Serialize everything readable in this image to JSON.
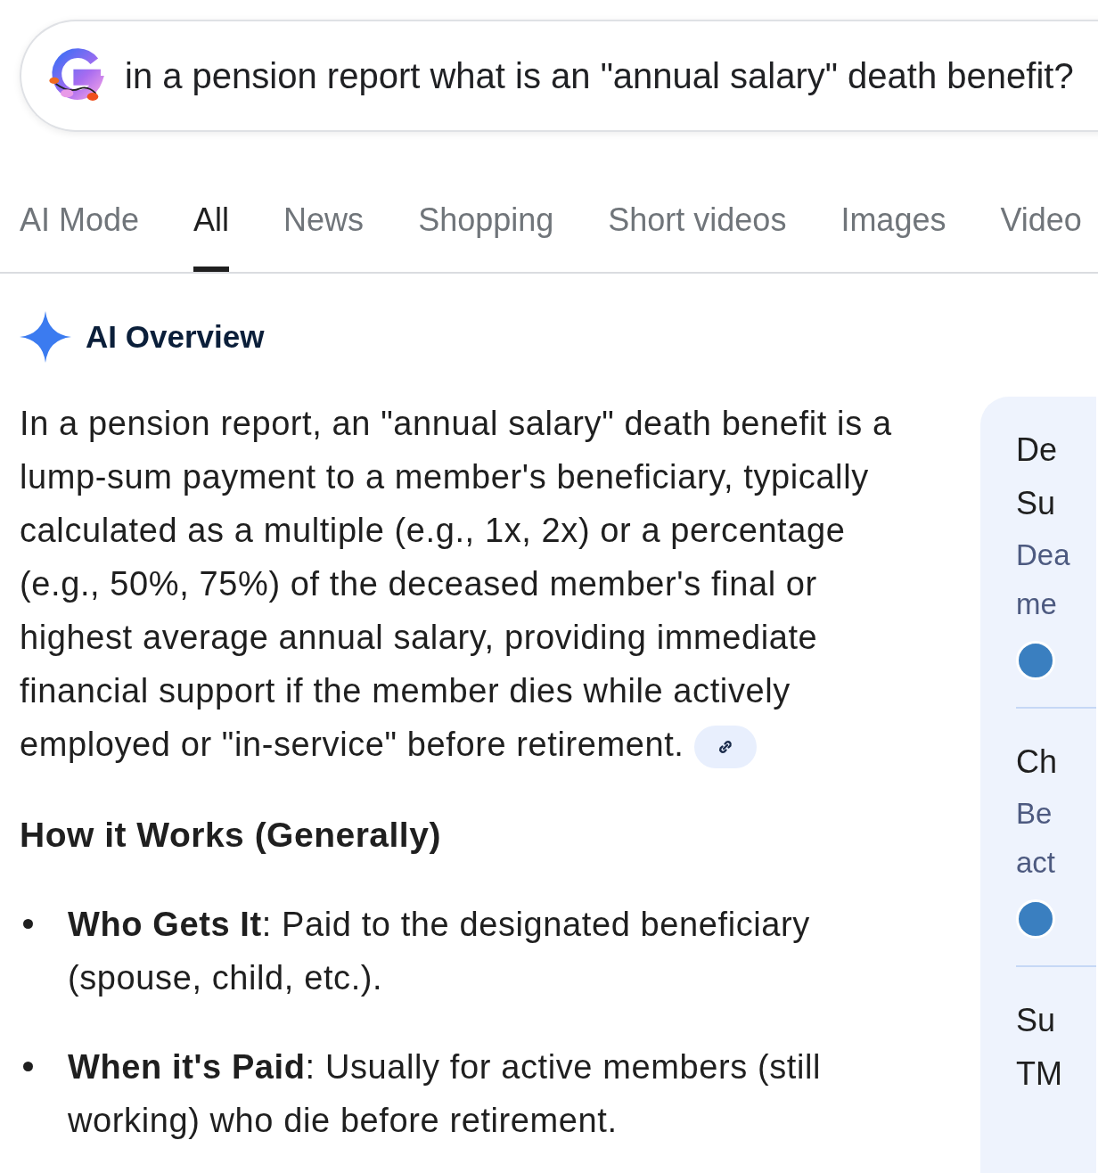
{
  "search": {
    "value": "in a pension report what is an \"annual salary\" death benefit?"
  },
  "tabs": [
    {
      "label": "AI Mode",
      "selected": false
    },
    {
      "label": "All",
      "selected": true
    },
    {
      "label": "News",
      "selected": false
    },
    {
      "label": "Shopping",
      "selected": false
    },
    {
      "label": "Short videos",
      "selected": false
    },
    {
      "label": "Images",
      "selected": false
    },
    {
      "label": "Video",
      "selected": false
    }
  ],
  "overview": {
    "title": "AI Overview",
    "summary": "In a pension report, an \"annual salary\" death benefit is a lump-sum payment to a member's beneficiary, typically calculated as a multiple (e.g., 1x, 2x) or a percentage (e.g., 50%, 75%) of the deceased member's final or highest average annual salary, providing immediate financial support if the member dies while actively employed or \"in-service\" before retirement.",
    "section_heading": "How it Works (Generally)",
    "bullets": [
      "**Who Gets It**: Paid to the designated beneficiary (spouse, child, etc.).",
      "**When it's Paid**: Usually for active members (still working) who die before retirement."
    ]
  },
  "side_panel": {
    "cards": [
      {
        "title_lines": [
          "De",
          "Su"
        ],
        "snippet_lines": [
          "Dea",
          "me"
        ],
        "has_source_icon": true
      },
      {
        "title_lines": [
          "Ch"
        ],
        "snippet_lines": [
          "Be",
          "act"
        ],
        "has_source_icon": true
      },
      {
        "title_lines": [
          "Su",
          "TM"
        ],
        "has_source_icon": false
      }
    ]
  }
}
